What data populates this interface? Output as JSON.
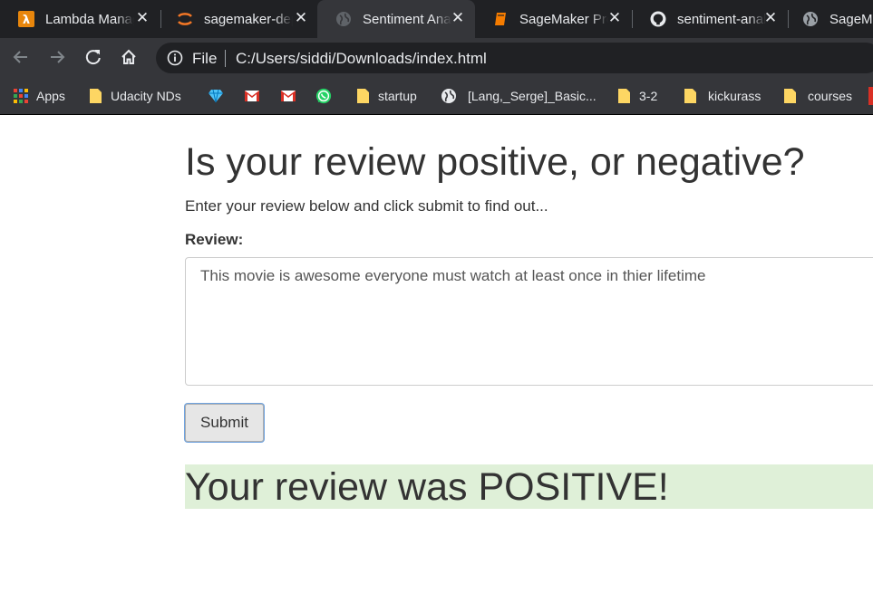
{
  "tabs": [
    {
      "title": "Lambda Management Console",
      "icon": "aws-lambda-icon",
      "active": false
    },
    {
      "title": "sagemaker-deployment",
      "icon": "jupyter-icon",
      "active": false
    },
    {
      "title": "Sentiment Analysis Web App",
      "icon": "globe-icon",
      "active": true
    },
    {
      "title": "SageMaker Project",
      "icon": "book-icon",
      "active": false
    },
    {
      "title": "sentiment-analysis",
      "icon": "github-icon",
      "active": false
    },
    {
      "title": "SageMaker",
      "icon": "globe-icon",
      "active": false
    }
  ],
  "toolbar": {
    "scheme": "File",
    "url": "C:/Users/siddi/Downloads/index.html"
  },
  "bookmarks": [
    {
      "label": "Apps",
      "icon": "apps-grid-icon"
    },
    {
      "label": "Udacity NDs",
      "icon": "folder-icon"
    },
    {
      "label": "",
      "icon": "gem-icon"
    },
    {
      "label": "",
      "icon": "gmail-icon"
    },
    {
      "label": "",
      "icon": "gmail-icon"
    },
    {
      "label": "",
      "icon": "whatsapp-icon"
    },
    {
      "label": "startup",
      "icon": "folder-icon"
    },
    {
      "label": "[Lang,_Serge]_Basic...",
      "icon": "globe-icon"
    },
    {
      "label": "3-2",
      "icon": "folder-icon"
    },
    {
      "label": "kickurass",
      "icon": "folder-icon"
    },
    {
      "label": "courses",
      "icon": "folder-icon"
    }
  ],
  "page": {
    "title": "Is your review positive, or negative?",
    "intro": "Enter your review below and click submit to find out...",
    "review_label": "Review:",
    "review_value": "This movie is awesome everyone must watch at least once in thier lifetime",
    "submit_label": "Submit",
    "result_text": "Your review was POSITIVE!"
  },
  "colors": {
    "tabstrip": "#202124",
    "toolbar": "#35363a",
    "result_bg": "#dff0d8",
    "text": "#333333"
  }
}
